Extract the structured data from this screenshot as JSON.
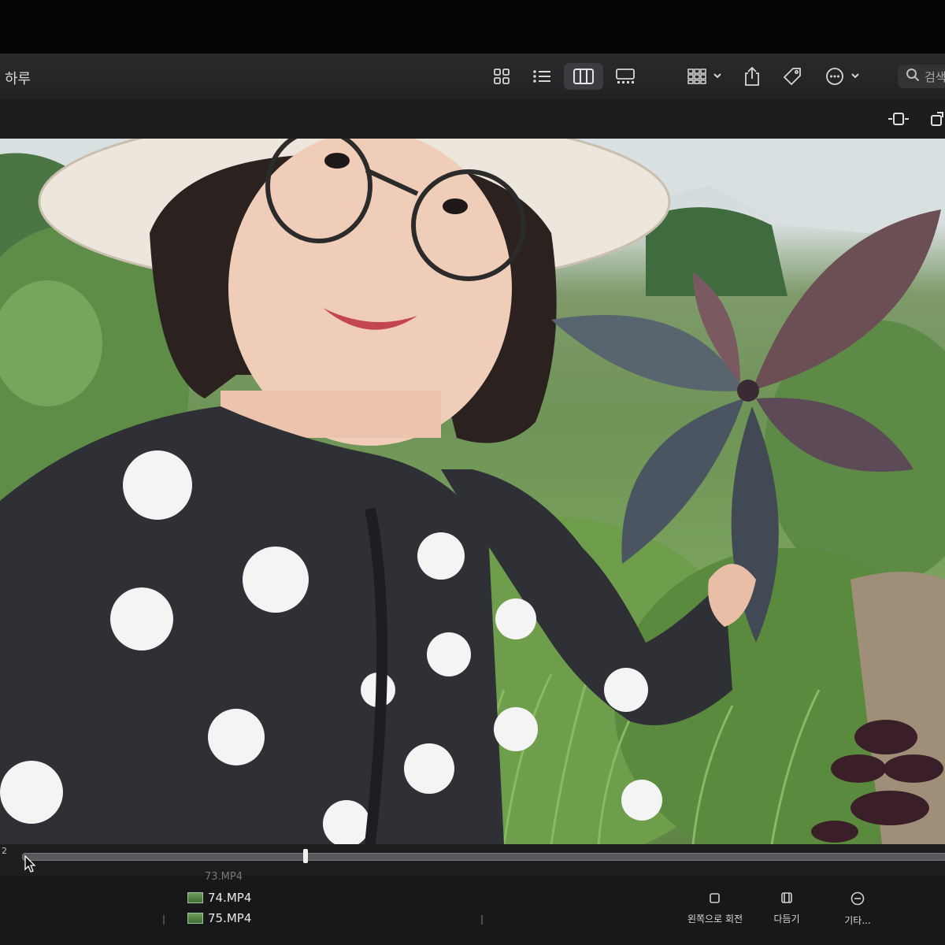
{
  "window": {
    "title": "하루"
  },
  "toolbar": {
    "icons": [
      "icon-view-icon",
      "list-view-icon",
      "column-view-icon",
      "gallery-view-icon",
      "group-icon",
      "share-icon",
      "tag-icon",
      "more-icon"
    ],
    "search_placeholder": "검색"
  },
  "viewer": {
    "index_label": "2"
  },
  "files": [
    {
      "name": "73.MP4"
    },
    {
      "name": "74.MP4"
    },
    {
      "name": "75.MP4"
    }
  ],
  "actions": [
    {
      "label": "왼쪽으로 회전",
      "icon": "rotate-left-icon"
    },
    {
      "label": "다듬기",
      "icon": "trim-icon"
    },
    {
      "label": "기타...",
      "icon": "more-circle-icon"
    }
  ],
  "colors": {
    "toolbar_bg": "#26262a",
    "accent_selected": "#3c3c40"
  }
}
